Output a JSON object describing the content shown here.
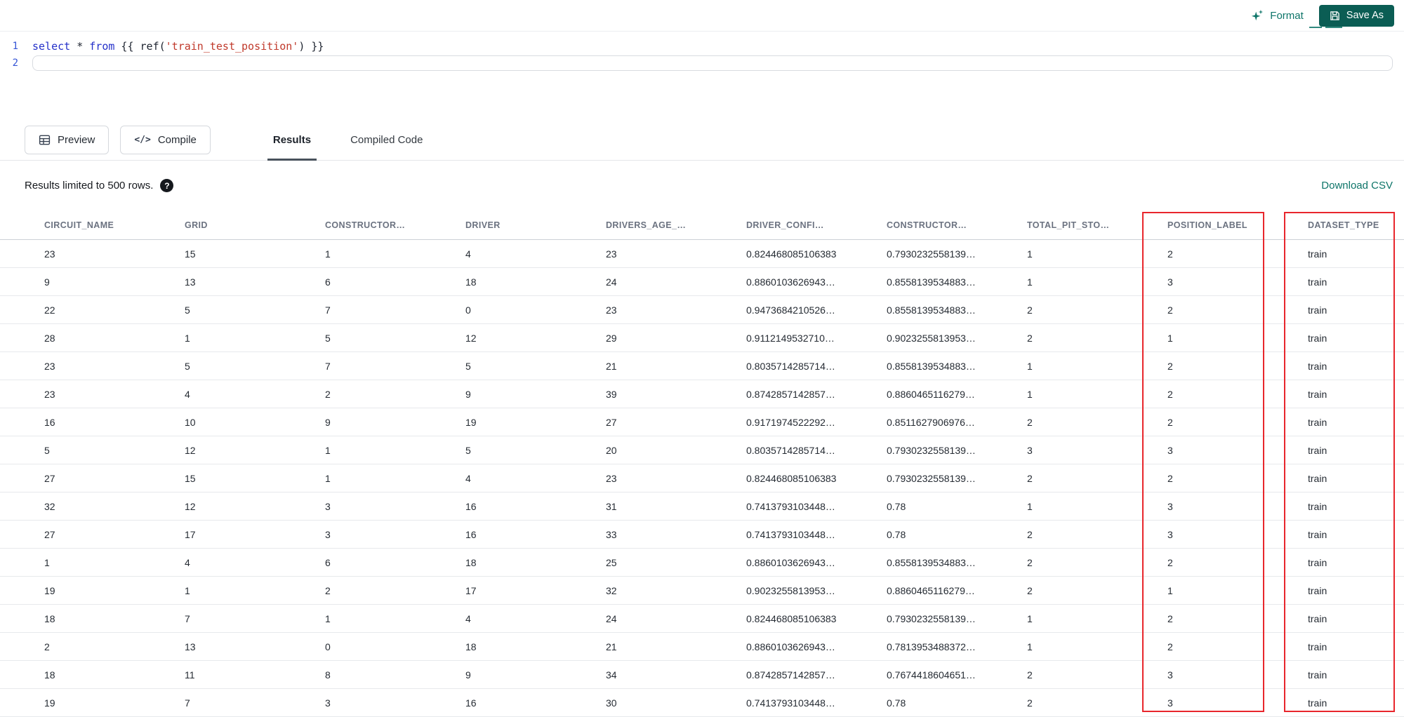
{
  "topbar": {
    "format_label": "Format",
    "save_as_label": "Save As"
  },
  "editor": {
    "lines": [
      {
        "number": "1",
        "active_box": false,
        "tokens": [
          {
            "t": "select",
            "c": "kw"
          },
          {
            "t": " * ",
            "c": "plain"
          },
          {
            "t": "from",
            "c": "kw"
          },
          {
            "t": " {{ ",
            "c": "plain"
          },
          {
            "t": "ref(",
            "c": "plain"
          },
          {
            "t": "'train_test_position'",
            "c": "str"
          },
          {
            "t": ") }}",
            "c": "plain"
          }
        ]
      },
      {
        "number": "2",
        "active_box": true,
        "tokens": []
      }
    ]
  },
  "toolbar": {
    "preview_label": "Preview",
    "compile_label": "Compile",
    "compile_icon_glyph": "</>",
    "tabs": [
      {
        "label": "Results",
        "active": true
      },
      {
        "label": "Compiled Code",
        "active": false
      }
    ]
  },
  "results": {
    "limit_text": "Results limited to 500 rows.",
    "help_glyph": "?",
    "download_csv_label": "Download CSV",
    "columns": [
      "CIRCUIT_NAME",
      "GRID",
      "CONSTRUCTOR…",
      "DRIVER",
      "DRIVERS_AGE_…",
      "DRIVER_CONFI…",
      "CONSTRUCTOR…",
      "TOTAL_PIT_STO…",
      "POSITION_LABEL",
      "DATASET_TYPE"
    ],
    "highlighted_columns": [
      "POSITION_LABEL",
      "DATASET_TYPE"
    ],
    "rows": [
      [
        "23",
        "15",
        "1",
        "4",
        "23",
        "0.824468085106383",
        "0.7930232558139…",
        "1",
        "2",
        "train"
      ],
      [
        "9",
        "13",
        "6",
        "18",
        "24",
        "0.8860103626943…",
        "0.8558139534883…",
        "1",
        "3",
        "train"
      ],
      [
        "22",
        "5",
        "7",
        "0",
        "23",
        "0.9473684210526…",
        "0.8558139534883…",
        "2",
        "2",
        "train"
      ],
      [
        "28",
        "1",
        "5",
        "12",
        "29",
        "0.9112149532710…",
        "0.9023255813953…",
        "2",
        "1",
        "train"
      ],
      [
        "23",
        "5",
        "7",
        "5",
        "21",
        "0.8035714285714…",
        "0.8558139534883…",
        "1",
        "2",
        "train"
      ],
      [
        "23",
        "4",
        "2",
        "9",
        "39",
        "0.8742857142857…",
        "0.8860465116279…",
        "1",
        "2",
        "train"
      ],
      [
        "16",
        "10",
        "9",
        "19",
        "27",
        "0.9171974522292…",
        "0.8511627906976…",
        "2",
        "2",
        "train"
      ],
      [
        "5",
        "12",
        "1",
        "5",
        "20",
        "0.8035714285714…",
        "0.7930232558139…",
        "3",
        "3",
        "train"
      ],
      [
        "27",
        "15",
        "1",
        "4",
        "23",
        "0.824468085106383",
        "0.7930232558139…",
        "2",
        "2",
        "train"
      ],
      [
        "32",
        "12",
        "3",
        "16",
        "31",
        "0.7413793103448…",
        "0.78",
        "1",
        "3",
        "train"
      ],
      [
        "27",
        "17",
        "3",
        "16",
        "33",
        "0.7413793103448…",
        "0.78",
        "2",
        "3",
        "train"
      ],
      [
        "1",
        "4",
        "6",
        "18",
        "25",
        "0.8860103626943…",
        "0.8558139534883…",
        "2",
        "2",
        "train"
      ],
      [
        "19",
        "1",
        "2",
        "17",
        "32",
        "0.9023255813953…",
        "0.8860465116279…",
        "2",
        "1",
        "train"
      ],
      [
        "18",
        "7",
        "1",
        "4",
        "24",
        "0.824468085106383",
        "0.7930232558139…",
        "1",
        "2",
        "train"
      ],
      [
        "2",
        "13",
        "0",
        "18",
        "21",
        "0.8860103626943…",
        "0.7813953488372…",
        "1",
        "2",
        "train"
      ],
      [
        "18",
        "11",
        "8",
        "9",
        "34",
        "0.8742857142857…",
        "0.7674418604651…",
        "2",
        "3",
        "train"
      ],
      [
        "19",
        "7",
        "3",
        "16",
        "30",
        "0.7413793103448…",
        "0.78",
        "2",
        "3",
        "train"
      ]
    ]
  },
  "colors": {
    "accent_teal": "#0e7569",
    "save_button": "#0b5d54",
    "highlight_red": "#e8262c"
  }
}
